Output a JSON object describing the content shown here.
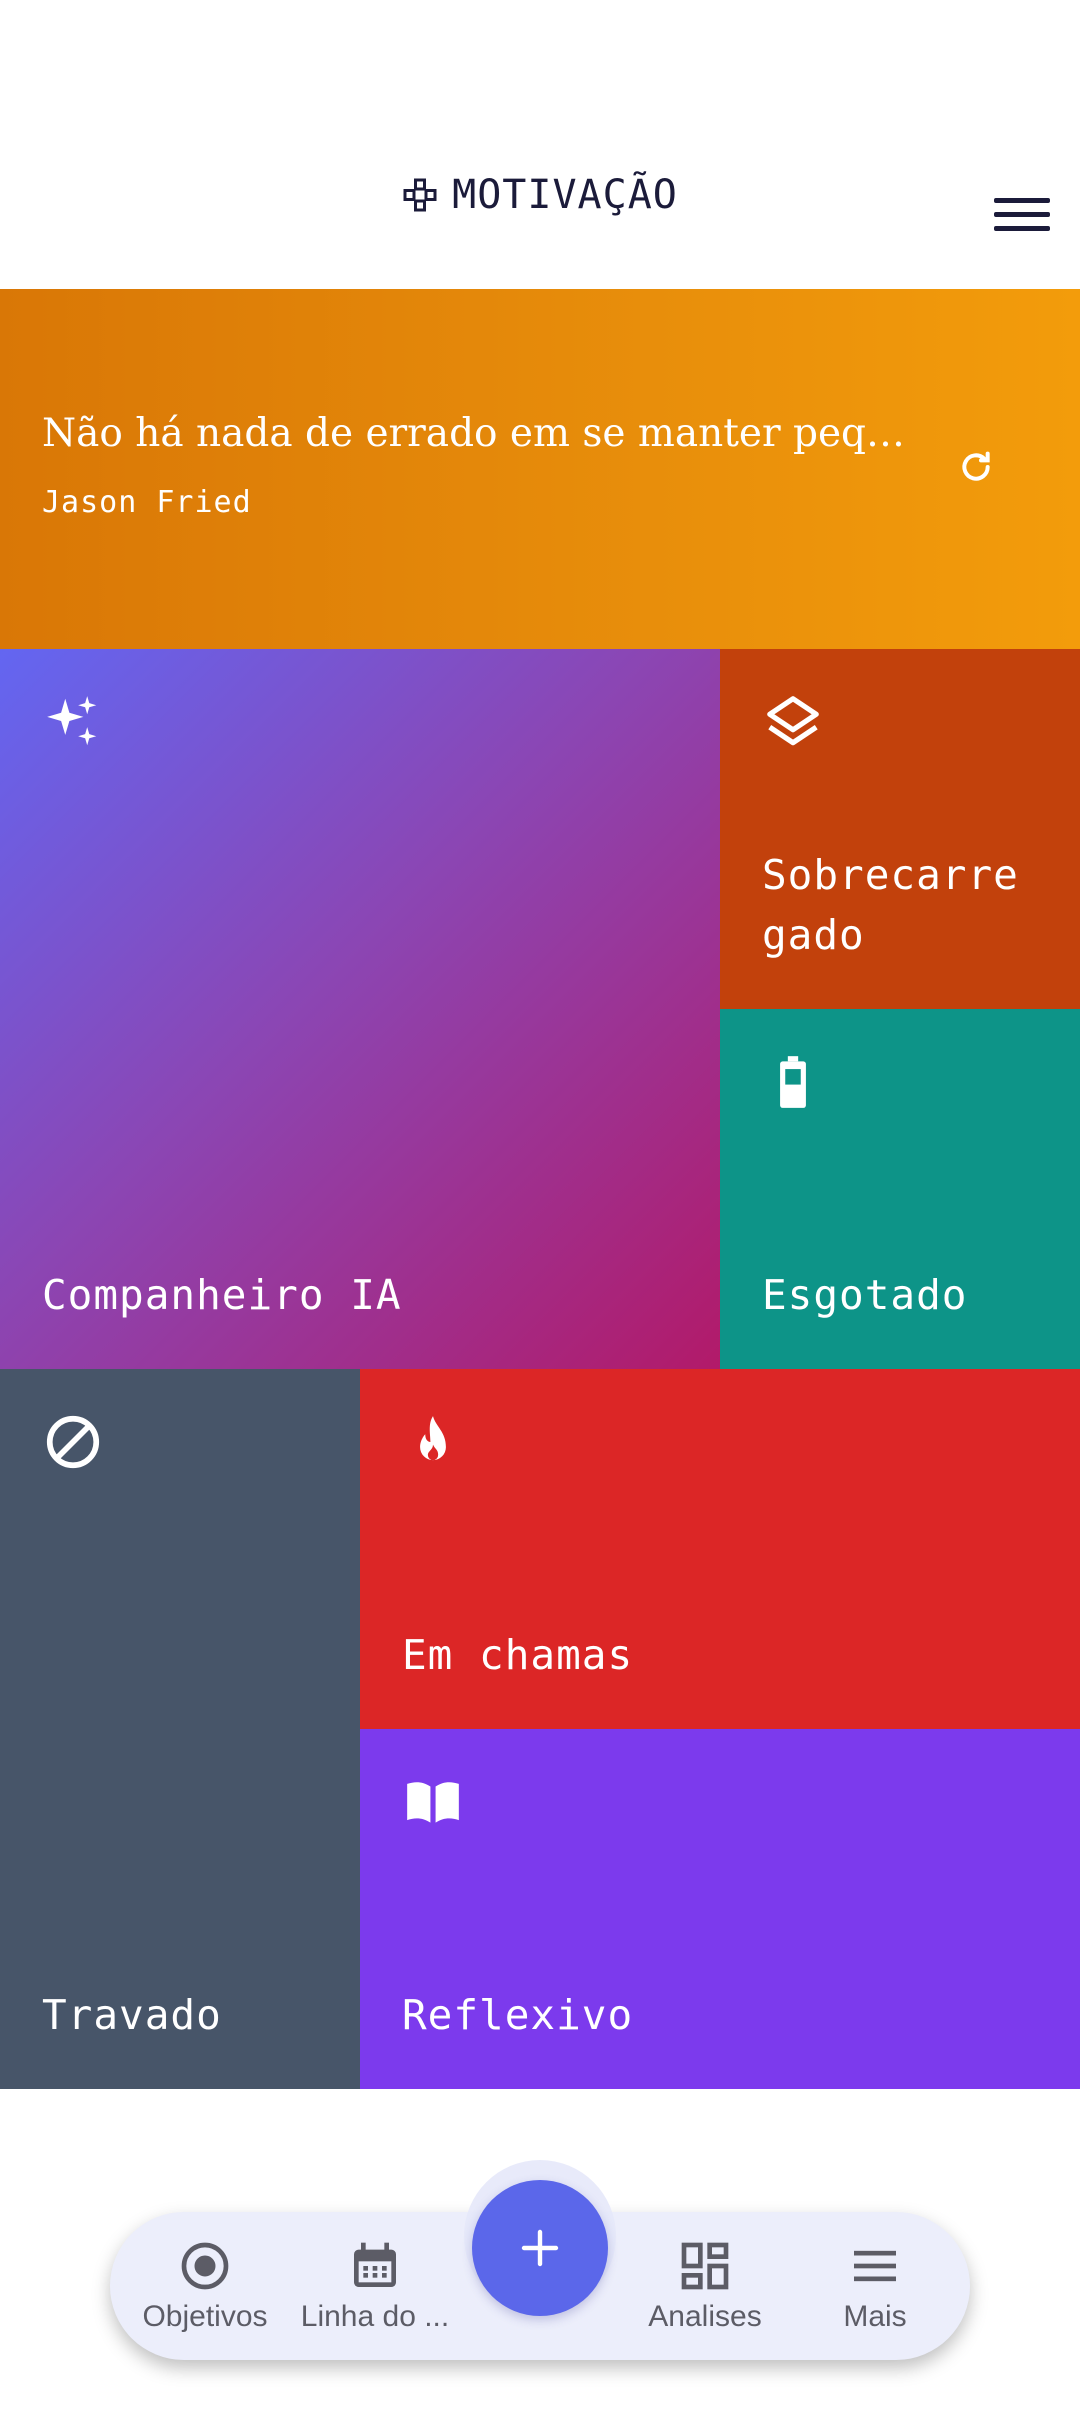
{
  "header": {
    "title": "MOTIVAÇÃO",
    "icons": {
      "brand": "gamepad-icon",
      "menu": "hamburger-menu-icon"
    }
  },
  "quote": {
    "text": "Não há nada de errado em se manter pequeno",
    "author": "Jason Fried",
    "icon": "refresh-icon",
    "colors": {
      "start": "#d97706",
      "end": "#f39c0b"
    }
  },
  "tiles": [
    {
      "id": "ai",
      "label": "Companheiro IA",
      "icon": "sparkles-icon",
      "color": "#6366f1"
    },
    {
      "id": "overloaded",
      "label": "Sobrecarre gado",
      "icon": "layers-icon",
      "color": "#c2410c"
    },
    {
      "id": "exhausted",
      "label": "Esgotado",
      "icon": "battery-icon",
      "color": "#0d9488"
    },
    {
      "id": "stuck",
      "label": "Travado",
      "icon": "block-icon",
      "color": "#475569"
    },
    {
      "id": "on-fire",
      "label": "Em chamas",
      "icon": "flame-icon",
      "color": "#dc2626"
    },
    {
      "id": "reflective",
      "label": "Reflexivo",
      "icon": "book-icon",
      "color": "#7c3aed"
    }
  ],
  "nav": {
    "items": [
      {
        "label": "Objetivos",
        "icon": "target-icon"
      },
      {
        "label": "Linha do ...",
        "icon": "calendar-icon"
      },
      {
        "label": "Analises",
        "icon": "dashboard-icon"
      },
      {
        "label": "Mais",
        "icon": "menu-icon"
      }
    ],
    "fab_icon": "plus-icon",
    "fab_color": "#5b67ea"
  }
}
